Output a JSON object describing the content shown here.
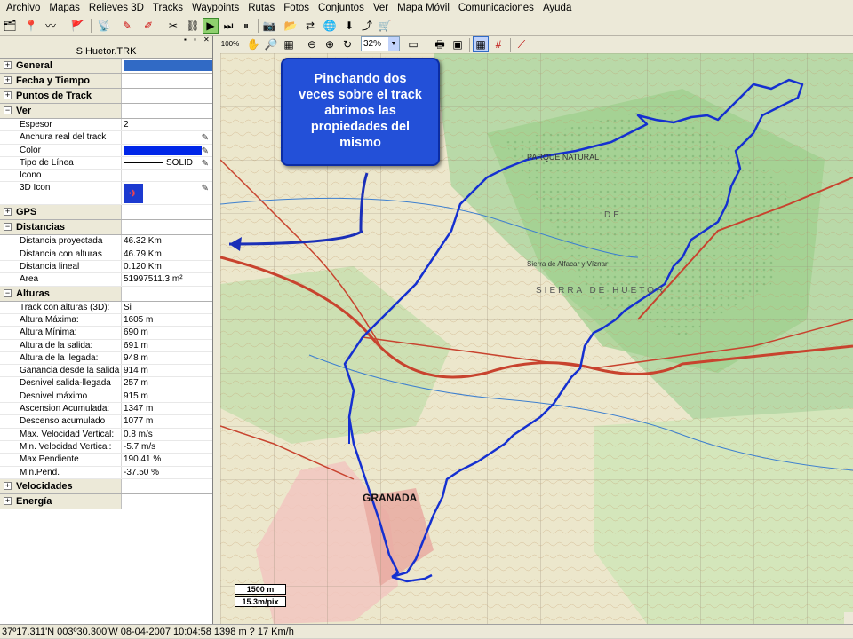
{
  "menu": [
    "Archivo",
    "Mapas",
    "Relieves 3D",
    "Tracks",
    "Waypoints",
    "Rutas",
    "Fotos",
    "Conjuntos",
    "Ver",
    "Mapa Móvil",
    "Comunicaciones",
    "Ayuda"
  ],
  "toolbar2": {
    "zoom_small": "100%",
    "zoom_value": "32%"
  },
  "panel": {
    "title": "S Huetor.TRK",
    "general": "General",
    "fecha": "Fecha y Tiempo",
    "puntos": "Puntos de Track",
    "ver": "Ver",
    "ver_rows": [
      {
        "label": "Espesor",
        "value": "2"
      },
      {
        "label": "Anchura real del track",
        "value": ""
      },
      {
        "label": "Color",
        "value": ""
      },
      {
        "label": "Tipo de Línea",
        "value": "SOLID"
      },
      {
        "label": "Icono",
        "value": ""
      },
      {
        "label": "3D Icon",
        "value": ""
      }
    ],
    "gps": "GPS",
    "distancias": "Distancias",
    "dist_rows": [
      {
        "label": "Distancia proyectada",
        "value": "46.32 Km"
      },
      {
        "label": "Distancia con alturas",
        "value": "46.79 Km"
      },
      {
        "label": "Distancia lineal",
        "value": "0.120 Km"
      },
      {
        "label": "Area",
        "value": "51997511.3 m²"
      }
    ],
    "alturas": "Alturas",
    "alt_rows": [
      {
        "label": "Track con alturas (3D):",
        "value": "Si"
      },
      {
        "label": "Altura Máxima:",
        "value": "1605 m"
      },
      {
        "label": "Altura Mínima:",
        "value": "690 m"
      },
      {
        "label": "Altura de la salida:",
        "value": "691 m"
      },
      {
        "label": "Altura de la llegada:",
        "value": "948 m"
      },
      {
        "label": "Ganancia desde la salida",
        "value": "914 m"
      },
      {
        "label": "Desnivel salida-llegada",
        "value": "257 m"
      },
      {
        "label": "Desnivel máximo",
        "value": "915 m"
      },
      {
        "label": "Ascension Acumulada:",
        "value": "1347 m"
      },
      {
        "label": "Descenso acumulado",
        "value": "1077 m"
      },
      {
        "label": "Max. Velocidad Vertical:",
        "value": "0.8 m/s"
      },
      {
        "label": "Min. Velocidad Vertical:",
        "value": "-5.7 m/s"
      },
      {
        "label": "Max Pendiente",
        "value": "190.41 %"
      },
      {
        "label": "Min.Pend.",
        "value": "-37.50 %"
      }
    ],
    "velocidades": "Velocidades",
    "energia": "Energía"
  },
  "callout": [
    "Pinchando dos",
    "veces sobre el track",
    "abrimos las",
    "propiedades del",
    "mismo"
  ],
  "map_labels": {
    "city": "GRANADA",
    "parque": "PARQUE NATURAL",
    "sierra_huetor": "SIERRA DE HUETOR",
    "de": "DE",
    "sierra_alfacar": "Sierra de Alfacar y Víznar"
  },
  "scale": {
    "distance": "1500 m",
    "resolution": "15.3m/pix"
  },
  "status": "37º17.311'N 003º30.300'W  08-04-2007  10:04:58  1398 m  ?  17 Km/h",
  "colors": {
    "track": "#1530d0",
    "callout": "#2350d8",
    "selection": "#0026e8"
  }
}
